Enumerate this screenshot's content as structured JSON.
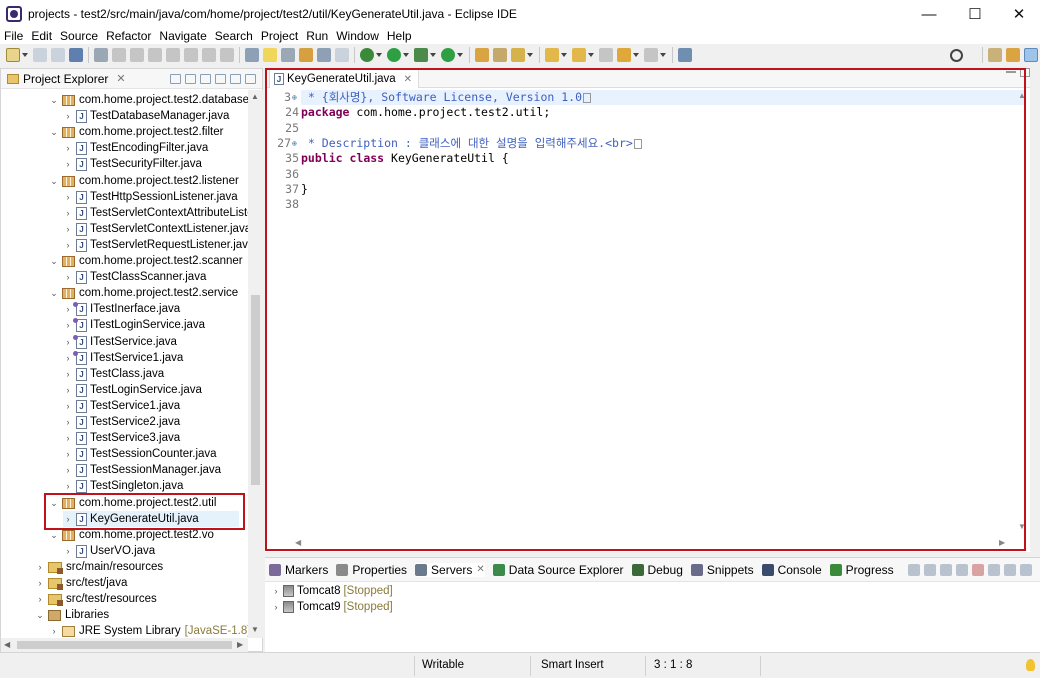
{
  "window": {
    "title": "projects - test2/src/main/java/com/home/project/test2/util/KeyGenerateUtil.java - Eclipse IDE",
    "controls": {
      "minimize": "—",
      "maximize": "☐",
      "close": "✕"
    }
  },
  "menu": [
    "File",
    "Edit",
    "Source",
    "Refactor",
    "Navigate",
    "Search",
    "Project",
    "Run",
    "Window",
    "Help"
  ],
  "explorer": {
    "title": "Project Explorer",
    "tree": [
      {
        "kind": "package",
        "label": "com.home.project.test2.database",
        "open": true
      },
      {
        "kind": "java",
        "label": "TestDatabaseManager.java"
      },
      {
        "kind": "package",
        "label": "com.home.project.test2.filter",
        "open": true
      },
      {
        "kind": "java",
        "label": "TestEncodingFilter.java"
      },
      {
        "kind": "java",
        "label": "TestSecurityFilter.java"
      },
      {
        "kind": "package",
        "label": "com.home.project.test2.listener",
        "open": true
      },
      {
        "kind": "java",
        "label": "TestHttpSessionListener.java"
      },
      {
        "kind": "java",
        "label": "TestServletContextAttributeListe"
      },
      {
        "kind": "java",
        "label": "TestServletContextListener.java"
      },
      {
        "kind": "java",
        "label": "TestServletRequestListener.java"
      },
      {
        "kind": "package",
        "label": "com.home.project.test2.scanner",
        "open": true
      },
      {
        "kind": "java",
        "label": "TestClassScanner.java"
      },
      {
        "kind": "package",
        "label": "com.home.project.test2.service",
        "open": true
      },
      {
        "kind": "iface",
        "label": "ITestInerface.java"
      },
      {
        "kind": "iface",
        "label": "ITestLoginService.java"
      },
      {
        "kind": "iface",
        "label": "ITestService.java"
      },
      {
        "kind": "iface",
        "label": "ITestService1.java"
      },
      {
        "kind": "java",
        "label": "TestClass.java"
      },
      {
        "kind": "java",
        "label": "TestLoginService.java"
      },
      {
        "kind": "java",
        "label": "TestService1.java"
      },
      {
        "kind": "java",
        "label": "TestService2.java"
      },
      {
        "kind": "java",
        "label": "TestService3.java"
      },
      {
        "kind": "java",
        "label": "TestSessionCounter.java"
      },
      {
        "kind": "java",
        "label": "TestSessionManager.java"
      },
      {
        "kind": "java",
        "label": "TestSingleton.java"
      },
      {
        "kind": "package",
        "label": "com.home.project.test2.util",
        "open": true
      },
      {
        "kind": "java",
        "label": "KeyGenerateUtil.java",
        "selected": true
      },
      {
        "kind": "package",
        "label": "com.home.project.test2.vo",
        "open": true
      },
      {
        "kind": "java",
        "label": "UserVO.java"
      },
      {
        "kind": "srcfolder",
        "label": "src/main/resources"
      },
      {
        "kind": "srcfolder",
        "label": "src/test/java"
      },
      {
        "kind": "srcfolder",
        "label": "src/test/resources"
      },
      {
        "kind": "libs",
        "label": "Libraries",
        "open": true
      },
      {
        "kind": "jre",
        "label": "JRE System Library",
        "decor": "[JavaSE-1.8]"
      }
    ]
  },
  "editor": {
    "tab_label": "KeyGenerateUtil.java",
    "lines": [
      {
        "num": "3",
        "fold": "⊕",
        "parts": [
          {
            "t": " * {회사명}, Software License, Version 1.0",
            "c": "cmt"
          }
        ],
        "box": true,
        "current": true
      },
      {
        "num": "24",
        "parts": [
          {
            "t": "package",
            "c": "kw"
          },
          {
            "t": " com.home.project.test2.util;",
            "c": ""
          }
        ]
      },
      {
        "num": "25",
        "parts": []
      },
      {
        "num": "27",
        "fold": "⊕",
        "parts": [
          {
            "t": " * Description : 클래스에 대한 설명을 입력해주세요.<br>",
            "c": "cmt"
          }
        ],
        "box": true
      },
      {
        "num": "35",
        "parts": [
          {
            "t": "public",
            "c": "kw"
          },
          {
            "t": " ",
            "c": ""
          },
          {
            "t": "class",
            "c": "kw"
          },
          {
            "t": " KeyGenerateUtil {",
            "c": ""
          }
        ]
      },
      {
        "num": "36",
        "parts": []
      },
      {
        "num": "37",
        "parts": [
          {
            "t": "}",
            "c": ""
          }
        ]
      },
      {
        "num": "38",
        "parts": []
      }
    ]
  },
  "bottom_panel": {
    "tabs": [
      {
        "label": "Markers",
        "color": "#7a6a9a"
      },
      {
        "label": "Properties",
        "color": "#8a8a8a"
      },
      {
        "label": "Servers",
        "color": "#6a7a8a",
        "active": true
      },
      {
        "label": "Data Source Explorer",
        "color": "#3c8a4a"
      },
      {
        "label": "Debug",
        "color": "#3a6a3a"
      },
      {
        "label": "Snippets",
        "color": "#6a6a8a"
      },
      {
        "label": "Console",
        "color": "#3a4a6a"
      },
      {
        "label": "Progress",
        "color": "#3a8a3a"
      }
    ],
    "servers": [
      {
        "name": "Tomcat8",
        "state": "[Stopped]"
      },
      {
        "name": "Tomcat9",
        "state": "[Stopped]"
      }
    ]
  },
  "status": {
    "writable": "Writable",
    "insert_mode": "Smart Insert",
    "position": "3 : 1 : 8"
  }
}
